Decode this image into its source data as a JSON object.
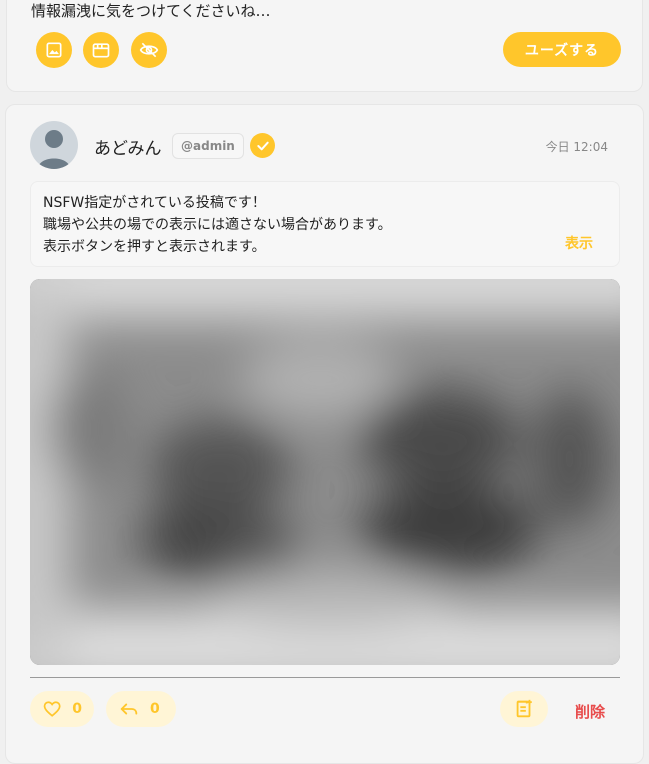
{
  "compose": {
    "text": "情報漏洩に気をつけてくださいね…",
    "use_button_label": "ユーズする",
    "tools": [
      "image-icon",
      "film-icon",
      "eye-off-icon"
    ]
  },
  "post": {
    "username": "あどみん",
    "handle": "@admin",
    "verified": true,
    "timestamp": "今日 12:04",
    "nsfw_notice": {
      "line1": "NSFW指定がされている投稿です！",
      "line2": "職場や公共の場での表示には適さない場合があります。",
      "line3": "表示ボタンを押すと表示されます。",
      "show_label": "表示"
    },
    "actions": {
      "likes": "0",
      "replies": "0",
      "delete_label": "削除"
    }
  },
  "colors": {
    "accent": "#ffc62b",
    "accent_light": "#fff5d6",
    "danger": "#e84c4c"
  }
}
